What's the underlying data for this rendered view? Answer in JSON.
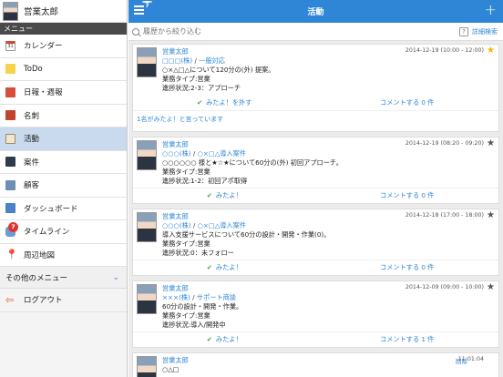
{
  "sidebar": {
    "user_name": "営業太郎",
    "menu_header": "メニュー",
    "items": [
      {
        "label": "カレンダー",
        "icon": "calendar-icon",
        "icon_text": "31"
      },
      {
        "label": "ToDo",
        "icon": "todo-icon"
      },
      {
        "label": "日報・週報",
        "icon": "report-icon"
      },
      {
        "label": "名刺",
        "icon": "business-card-icon"
      },
      {
        "label": "活動",
        "icon": "activity-icon",
        "active": true
      },
      {
        "label": "案件",
        "icon": "case-icon"
      },
      {
        "label": "顧客",
        "icon": "customer-icon"
      },
      {
        "label": "ダッシュボード",
        "icon": "dashboard-icon"
      },
      {
        "label": "タイムライン",
        "icon": "timeline-icon",
        "badge": "7"
      },
      {
        "label": "周辺地図",
        "icon": "map-pin-icon"
      }
    ],
    "other_menu_label": "その他のメニュー",
    "logout_label": "ログアウト"
  },
  "header": {
    "title": "活動",
    "menu_badge": "7"
  },
  "search": {
    "placeholder": "履歴から絞り込む",
    "advanced_label": "詳細検索",
    "help_text": "?"
  },
  "colors": {
    "accent": "#2f86d6",
    "star_active": "#f4b400",
    "like_check": "#3aa24a"
  },
  "feed": [
    {
      "user": "営業太郎",
      "company": "□□□(株)",
      "subject": "一般対応",
      "date": "2014-12-19 (10:00 - 12:00)",
      "starred": true,
      "summary": "○×△□△について120分の(外) 提案。",
      "type_line": "業務タイプ:営業",
      "status_line": "進捗状況:2-3：アプローチ",
      "like_label": "みたよ！を外す",
      "comment_label": "コメントする 0 件",
      "likes_text": "1名がみたよ！と言っています"
    },
    {
      "user": "営業太郎",
      "company": "○○○(株)",
      "subject": "○×□△導入案件",
      "date": "2014-12-19 (08:20 - 09:20)",
      "starred": false,
      "summary": "○○○○○○ 様と★☆★について60分の(外) 初回アプローチ。",
      "type_line": "業務タイプ:営業",
      "status_line": "進捗状況:1-2：初回アポ取得",
      "like_label": "みたよ！",
      "comment_label": "コメントする 0 件"
    },
    {
      "user": "営業太郎",
      "company": "○○○(株)",
      "subject": "○×□△導入案件",
      "date": "2014-12-18 (17:00 - 18:00)",
      "starred": false,
      "summary": "導入支援サービスについて60分の設計・開発・作業(0)。",
      "type_line": "業務タイプ:営業",
      "status_line": "進捗状況:0：未フォロー",
      "like_label": "みたよ！",
      "comment_label": "コメントする 0 件"
    },
    {
      "user": "営業太郎",
      "company": "×××(株)",
      "subject": "サポート商談",
      "date": "2014-12-09 (09:00 - 10:00)",
      "starred": false,
      "summary": "60分の設計・開発・作業。",
      "type_line": "業務タイプ:営業",
      "status_line": "進捗状況:導入/開発中",
      "like_label": "みたよ！",
      "comment_label": "コメントする 1 件"
    },
    {
      "user": "営業太郎",
      "summary": "○△□",
      "delete_label": "削除",
      "date": "11:01:04"
    }
  ]
}
